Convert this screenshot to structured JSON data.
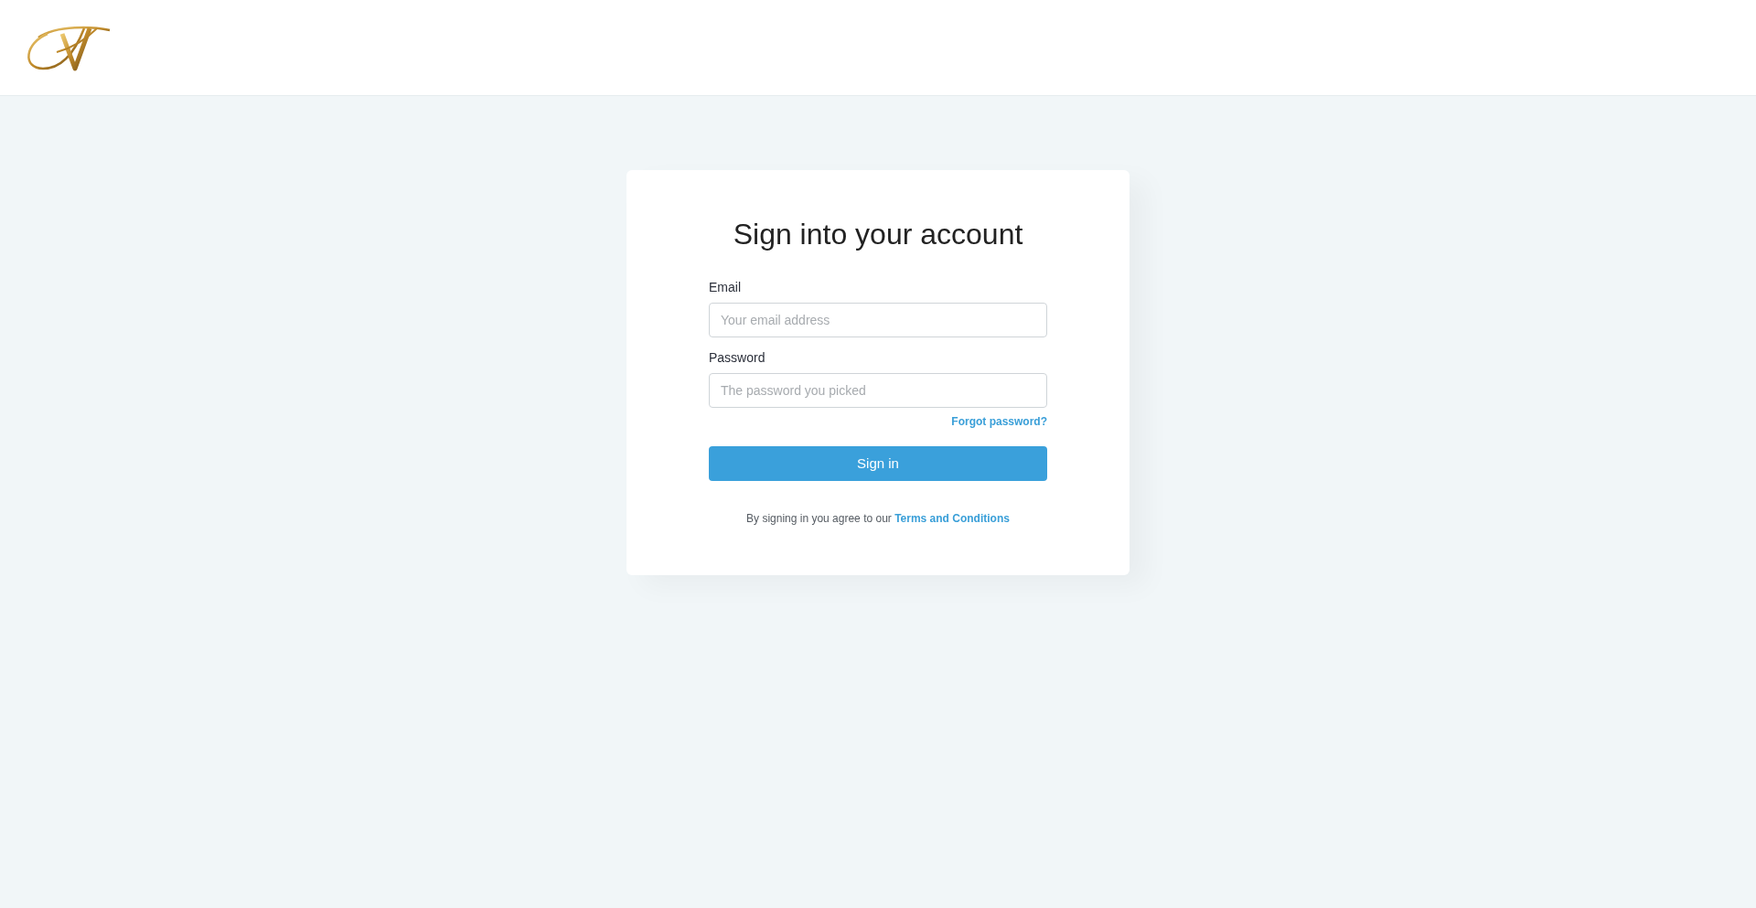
{
  "card": {
    "title": "Sign into your account",
    "fields": [
      {
        "label": "Email",
        "placeholder": "Your email address"
      },
      {
        "label": "Password",
        "placeholder": "The password you picked"
      }
    ],
    "forgot_link": "Forgot password?",
    "submit": "Sign in",
    "terms": {
      "text": "By signing in you agree to our",
      "link": "Terms and Conditions"
    }
  }
}
